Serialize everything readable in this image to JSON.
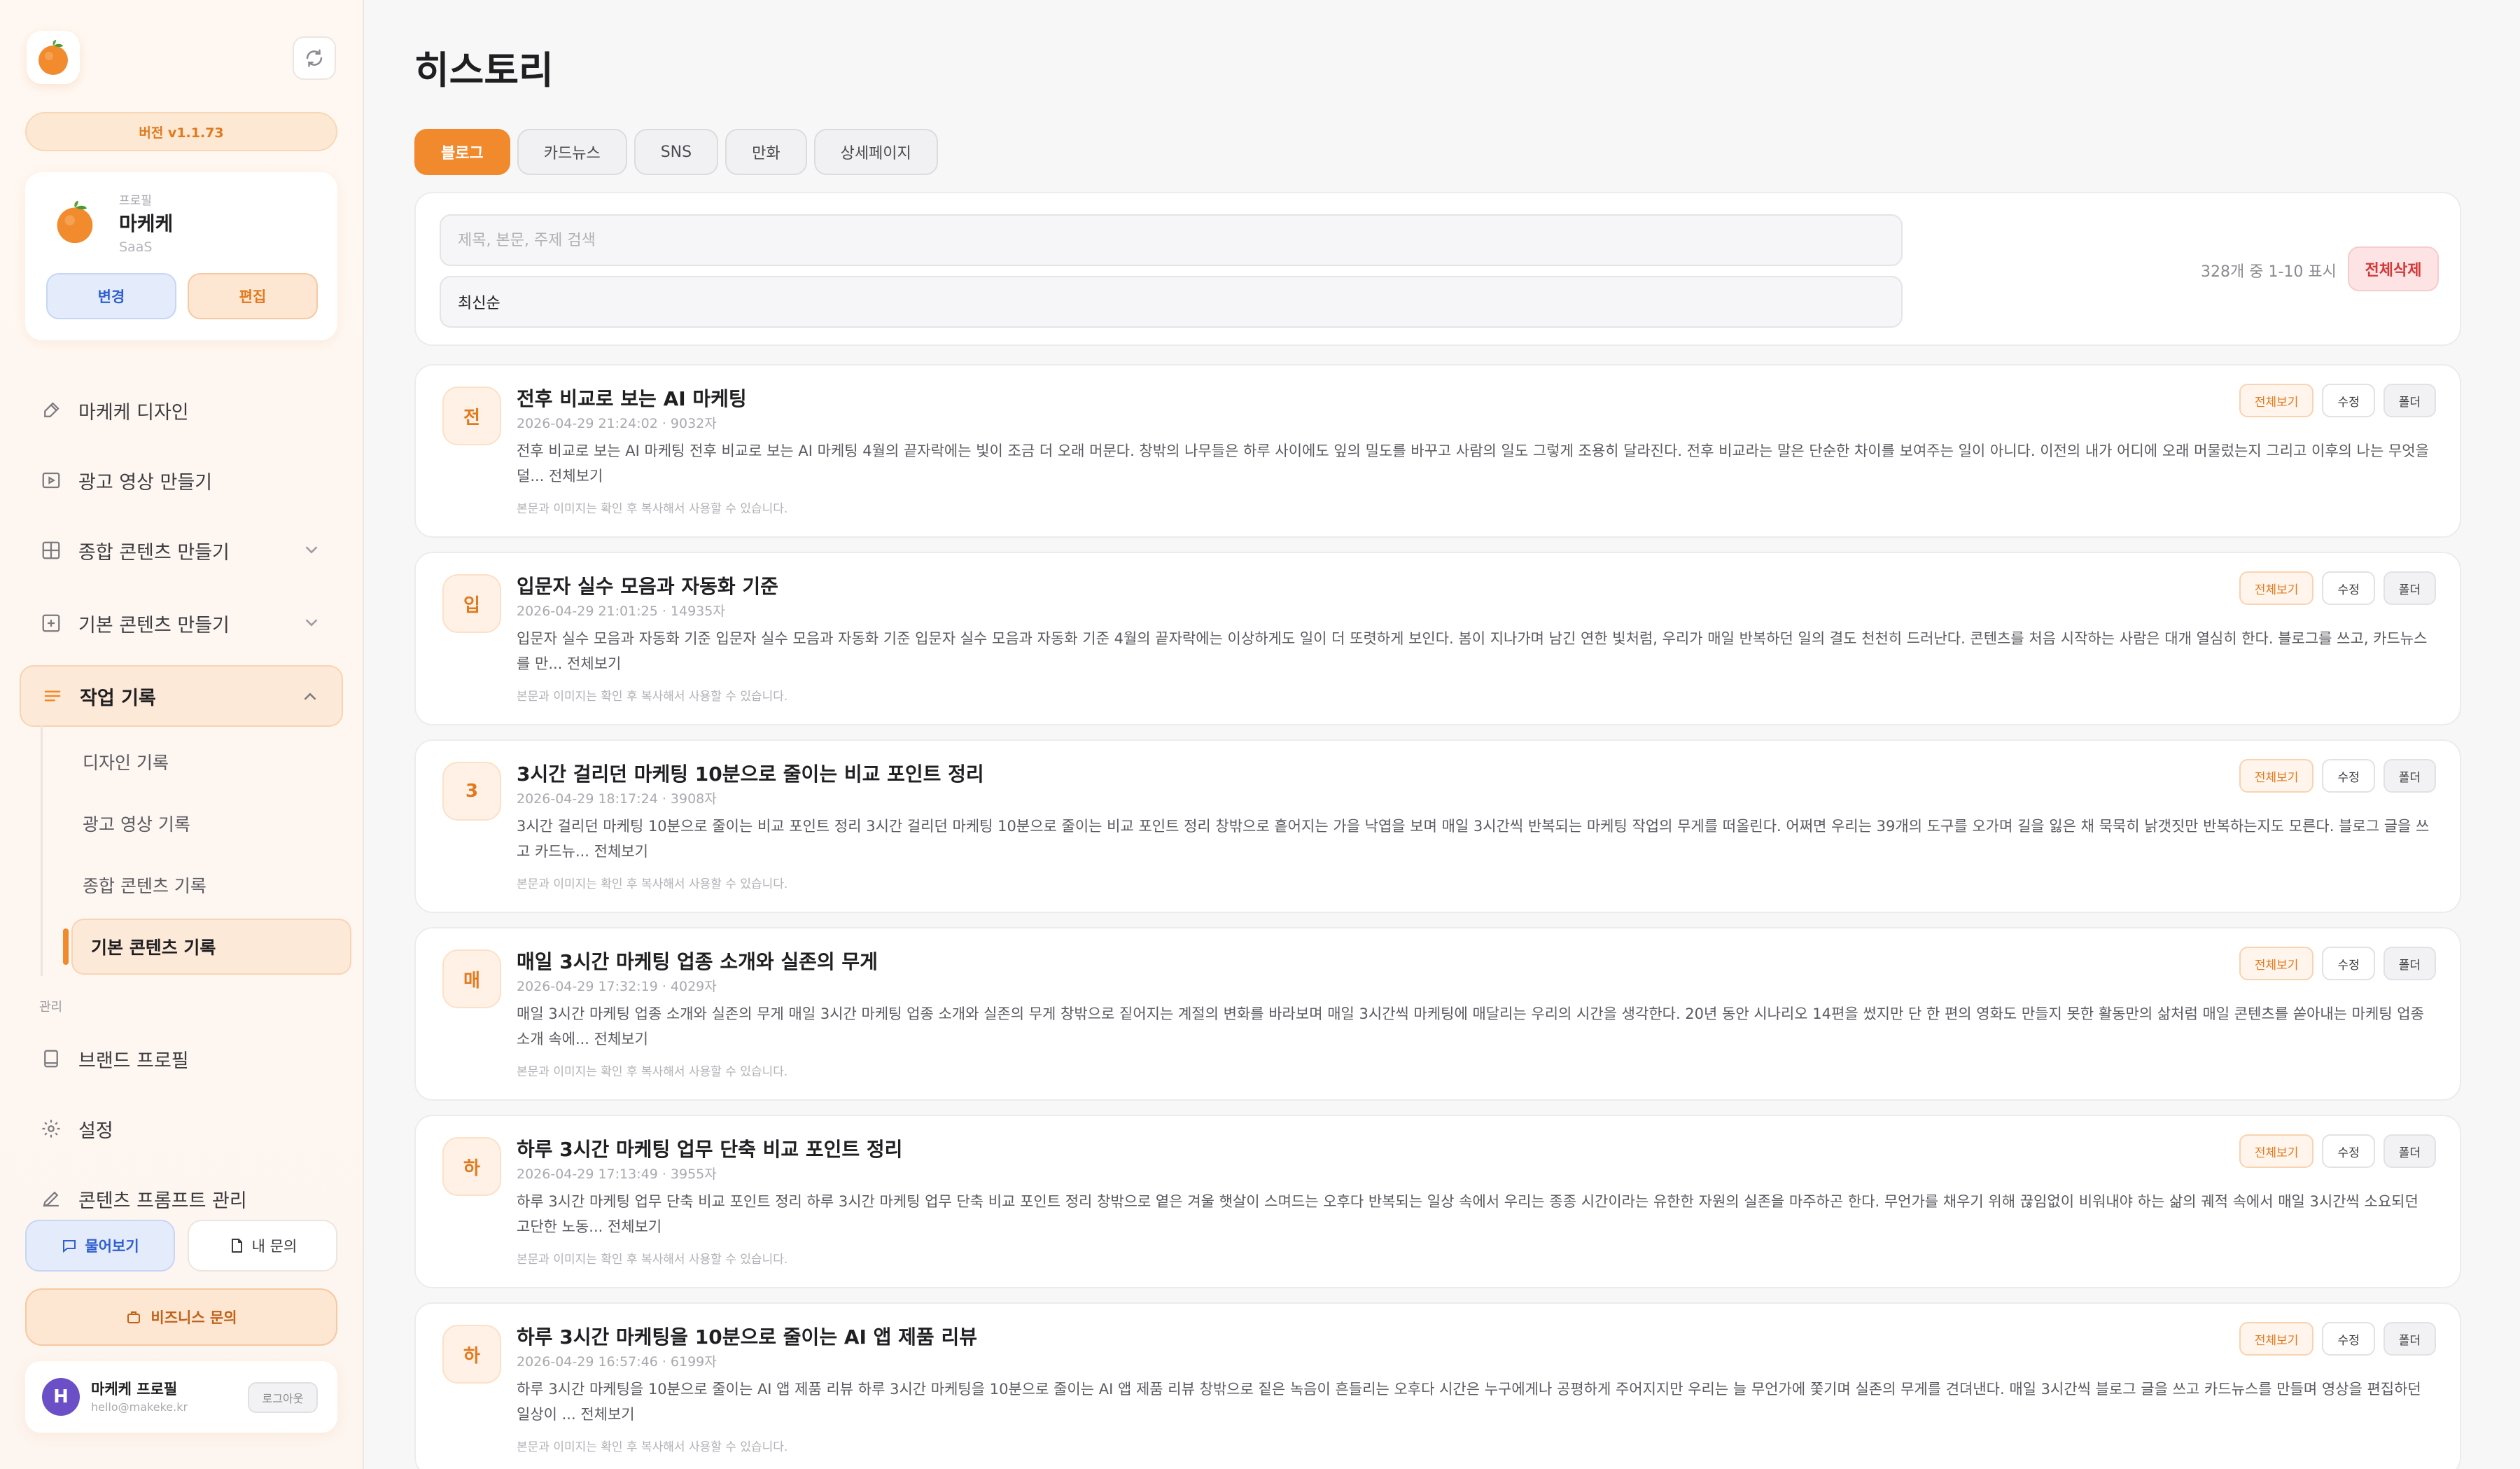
{
  "app": {
    "version_label": "버전 v1.1.73"
  },
  "profile": {
    "caption": "프로필",
    "name": "마케케",
    "type": "SaaS",
    "change_label": "변경",
    "edit_label": "편집"
  },
  "nav": {
    "items": [
      {
        "label": "마케케 디자인",
        "icon": "brush-icon"
      },
      {
        "label": "광고 영상 만들기",
        "icon": "video-icon"
      },
      {
        "label": "종합 콘텐츠 만들기",
        "icon": "grid-icon"
      },
      {
        "label": "기본 콘텐츠 만들기",
        "icon": "plus-square-icon"
      },
      {
        "label": "작업 기록",
        "icon": "list-icon"
      }
    ],
    "sub_items": [
      {
        "label": "디자인 기록"
      },
      {
        "label": "광고 영상 기록"
      },
      {
        "label": "종합 콘텐츠 기록"
      },
      {
        "label": "기본 콘텐츠 기록"
      }
    ],
    "admin_section_label": "관리",
    "admin_items": [
      {
        "label": "브랜드 프로필",
        "icon": "book-icon"
      },
      {
        "label": "설정",
        "icon": "gear-icon"
      },
      {
        "label": "콘텐츠 프롬프트 관리",
        "icon": "pen-icon"
      }
    ]
  },
  "support": {
    "ask_label": "물어보기",
    "my_questions_label": "내 문의",
    "business_label": "비즈니스 문의"
  },
  "user": {
    "initial": "H",
    "name": "마케케 프로필",
    "email": "hello@makeke.kr",
    "logout_label": "로그아웃"
  },
  "page": {
    "title": "히스토리"
  },
  "tabs": [
    {
      "label": "블로그",
      "active": true
    },
    {
      "label": "카드뉴스",
      "active": false
    },
    {
      "label": "SNS",
      "active": false
    },
    {
      "label": "만화",
      "active": false
    },
    {
      "label": "상세페이지",
      "active": false
    }
  ],
  "filter": {
    "search_placeholder": "제목, 본문, 주제 검색",
    "sort_value": "최신순",
    "count_text": "328개 중 1-10 표시",
    "delete_all_label": "전체삭제"
  },
  "entry_actions": {
    "view_label": "전체보기",
    "edit_label": "수정",
    "folder_label": "폴더"
  },
  "entries": [
    {
      "initial": "전",
      "title": "전후 비교로 보는 AI 마케팅",
      "meta": "2026-04-29 21:24:02 · 9032자",
      "body": "전후 비교로 보는 AI 마케팅 전후 비교로 보는 AI 마케팅 4월의 끝자락에는 빛이 조금 더 오래 머문다. 창밖의 나무들은 하루 사이에도 잎의 밀도를 바꾸고 사람의 일도 그렇게 조용히 달라진다. 전후 비교라는 말은 단순한 차이를 보여주는 일이 아니다. 이전의 내가 어디에 오래 머물렀는지 그리고 이후의 나는 무엇을 덜... 전체보기",
      "note": "본문과 이미지는 확인 후 복사해서 사용할 수 있습니다."
    },
    {
      "initial": "입",
      "title": "입문자 실수 모음과 자동화 기준",
      "meta": "2026-04-29 21:01:25 · 14935자",
      "body": "입문자 실수 모음과 자동화 기준 입문자 실수 모음과 자동화 기준 입문자 실수 모음과 자동화 기준 4월의 끝자락에는 이상하게도 일이 더 또렷하게 보인다. 봄이 지나가며 남긴 연한 빛처럼, 우리가 매일 반복하던 일의 결도 천천히 드러난다. 콘텐츠를 처음 시작하는 사람은 대개 열심히 한다. 블로그를 쓰고, 카드뉴스를 만... 전체보기",
      "note": "본문과 이미지는 확인 후 복사해서 사용할 수 있습니다."
    },
    {
      "initial": "3",
      "title": "3시간 걸리던 마케팅 10분으로 줄이는 비교 포인트 정리",
      "meta": "2026-04-29 18:17:24 · 3908자",
      "body": "3시간 걸리던 마케팅 10분으로 줄이는 비교 포인트 정리 3시간 걸리던 마케팅 10분으로 줄이는 비교 포인트 정리 창밖으로 흩어지는 가을 낙엽을 보며 매일 3시간씩 반복되는 마케팅 작업의 무게를 떠올린다. 어쩌면 우리는 39개의 도구를 오가며 길을 잃은 채 묵묵히 낡갯짓만 반복하는지도 모른다. 블로그 글을 쓰고 카드뉴... 전체보기",
      "note": "본문과 이미지는 확인 후 복사해서 사용할 수 있습니다."
    },
    {
      "initial": "매",
      "title": "매일 3시간 마케팅 업종 소개와 실존의 무게",
      "meta": "2026-04-29 17:32:19 · 4029자",
      "body": "매일 3시간 마케팅 업종 소개와 실존의 무게 매일 3시간 마케팅 업종 소개와 실존의 무게 창밖으로 짙어지는 계절의 변화를 바라보며 매일 3시간씩 마케팅에 매달리는 우리의 시간을 생각한다. 20년 동안 시나리오 14편을 썼지만 단 한 편의 영화도 만들지 못한 활동만의 삶처럼 매일 콘텐츠를 쏟아내는 마케팅 업종 소개 속에... 전체보기",
      "note": "본문과 이미지는 확인 후 복사해서 사용할 수 있습니다."
    },
    {
      "initial": "하",
      "title": "하루 3시간 마케팅 업무 단축 비교 포인트 정리",
      "meta": "2026-04-29 17:13:49 · 3955자",
      "body": "하루 3시간 마케팅 업무 단축 비교 포인트 정리 하루 3시간 마케팅 업무 단축 비교 포인트 정리 창밖으로 옅은 겨울 햇살이 스며드는 오후다 반복되는 일상 속에서 우리는 종종 시간이라는 유한한 자원의 실존을 마주하곤 한다. 무언가를 채우기 위해 끊임없이 비워내야 하는 삶의 궤적 속에서 매일 3시간씩 소요되던 고단한 노동... 전체보기",
      "note": "본문과 이미지는 확인 후 복사해서 사용할 수 있습니다."
    },
    {
      "initial": "하",
      "title": "하루 3시간 마케팅을 10분으로 줄이는 AI 앱 제품 리뷰",
      "meta": "2026-04-29 16:57:46 · 6199자",
      "body": "하루 3시간 마케팅을 10분으로 줄이는 AI 앱 제품 리뷰 하루 3시간 마케팅을 10분으로 줄이는 AI 앱 제품 리뷰 창밖으로 짙은 녹음이 흔들리는 오후다 시간은 누구에게나 공평하게 주어지지만 우리는 늘 무언가에 쫓기며 실존의 무게를 견뎌낸다. 매일 3시간씩 블로그 글을 쓰고 카드뉴스를 만들며 영상을 편집하던 일상이 ... 전체보기",
      "note": "본문과 이미지는 확인 후 복사해서 사용할 수 있습니다."
    }
  ],
  "colors": {
    "accent": "#f08a2c",
    "accent_soft": "#fde9d8",
    "blue": "#2f5fd0",
    "danger": "#d33a3a",
    "avatar_purple": "#6b4fc6"
  }
}
